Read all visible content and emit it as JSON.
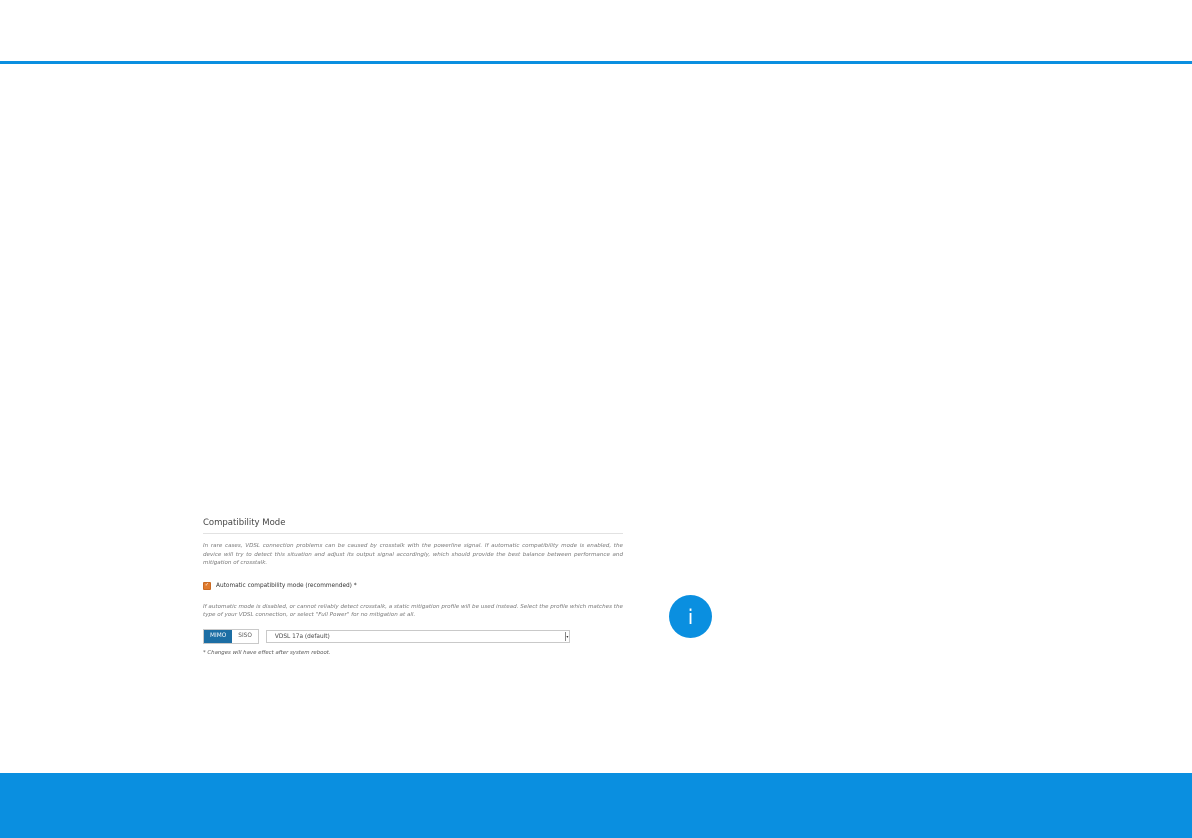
{
  "section": {
    "title": "Compatibility Mode",
    "description": "In rare cases, VDSL connection problems can be caused by crosstalk with the powerline signal. If automatic compatibility mode is enabled, the device will try to detect this situation and adjust its output signal accordingly, which should provide the best balance between performance and mitigation of crosstalk.",
    "checkbox": {
      "checked": true,
      "label": "Automatic compatibility mode (recommended) *"
    },
    "description2": "If automatic mode is disabled, or cannot reliably detect crosstalk, a static mitigation profile will be used instead. Select the profile which matches the type of your VDSL connection, or select \"Full Power\" for no mitigation at all.",
    "toggle": {
      "options": [
        "MIMO",
        "SISO"
      ],
      "selected": "MIMO"
    },
    "profile_select": {
      "value": "VDSL 17a (default)"
    },
    "footnote": "* Changes will have effect after system reboot."
  },
  "info_badge": {
    "glyph": "i",
    "icon": "info-icon"
  },
  "colors": {
    "accent": "#0a8fe0",
    "checkbox": "#e07b2e",
    "toggle_active": "#1c6ea4"
  }
}
